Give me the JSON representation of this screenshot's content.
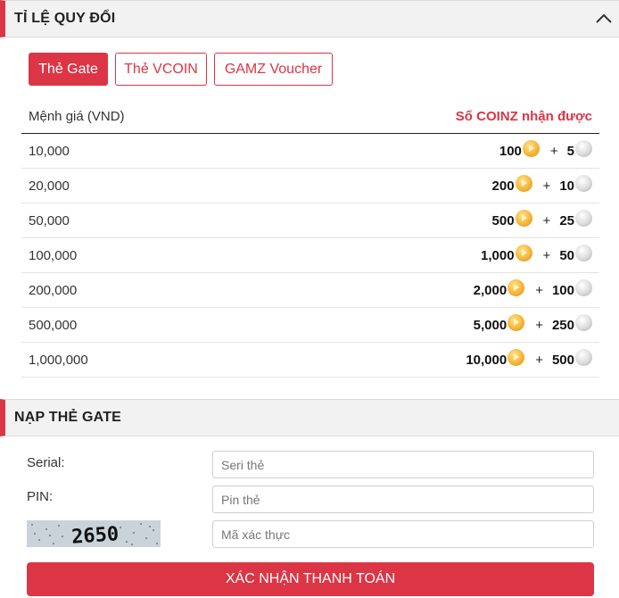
{
  "exchange_section": {
    "title": "TỈ LỆ QUY ĐỔI"
  },
  "tabs": [
    {
      "label": "Thẻ Gate",
      "active": true
    },
    {
      "label": "Thẻ VCOIN",
      "active": false
    },
    {
      "label": "GAMZ Voucher",
      "active": false
    }
  ],
  "table": {
    "col_left": "Mệnh giá (VND)",
    "col_right": "Số COINZ nhận được",
    "rows": [
      {
        "denomination": "10,000",
        "coinz": "100",
        "bonus": "5"
      },
      {
        "denomination": "20,000",
        "coinz": "200",
        "bonus": "10"
      },
      {
        "denomination": "50,000",
        "coinz": "500",
        "bonus": "25"
      },
      {
        "denomination": "100,000",
        "coinz": "1,000",
        "bonus": "50"
      },
      {
        "denomination": "200,000",
        "coinz": "2,000",
        "bonus": "100"
      },
      {
        "denomination": "500,000",
        "coinz": "5,000",
        "bonus": "250"
      },
      {
        "denomination": "1,000,000",
        "coinz": "10,000",
        "bonus": "500"
      }
    ],
    "plus_sign": "+"
  },
  "topup_section": {
    "title": "NẠP THẺ GATE",
    "serial_label": "Serial:",
    "serial_placeholder": "Seri thẻ",
    "pin_label": "PIN:",
    "pin_placeholder": "Pin thẻ",
    "captcha_text": "2650",
    "captcha_placeholder": "Mã xác thực",
    "submit_label": "XÁC NHẬN THANH TOÁN"
  },
  "colors": {
    "accent": "#dc3545",
    "header_bg": "#f2f2f2"
  },
  "icons": {
    "collapse": "chevron-up-icon",
    "gold_coin": "gold-coin-icon",
    "silver_coin": "silver-coin-icon"
  }
}
